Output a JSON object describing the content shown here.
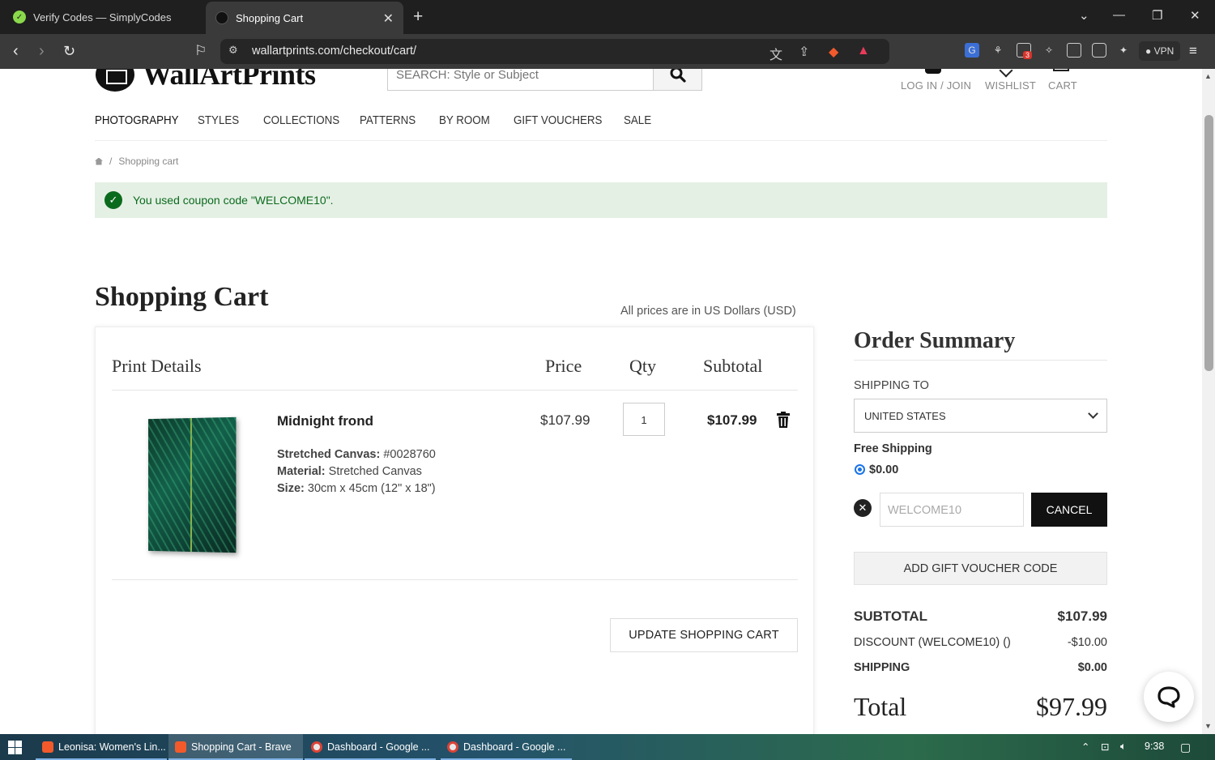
{
  "browser": {
    "tabs": [
      {
        "title": "Verify Codes — SimplyCodes",
        "active": false
      },
      {
        "title": "Shopping Cart",
        "active": true
      }
    ],
    "url": "wallartprints.com/checkout/cart/",
    "vpn_label": "VPN",
    "extension_badge": "3",
    "brave_badge": "8"
  },
  "site": {
    "logo_text": "WallArtPrints",
    "search_placeholder": "SEARCH: Style or Subject",
    "header_links": {
      "login": "LOG IN / JOIN",
      "wishlist": "WISHLIST",
      "cart": "CART"
    },
    "nav": [
      "PHOTOGRAPHY",
      "STYLES",
      "COLLECTIONS",
      "PATTERNS",
      "BY ROOM",
      "GIFT VOUCHERS",
      "SALE"
    ]
  },
  "breadcrumb": {
    "separator": "/",
    "current": "Shopping cart"
  },
  "notice": {
    "text": "You used coupon code \"WELCOME10\"."
  },
  "cart": {
    "title": "Shopping Cart",
    "currency_note": "All prices are in US Dollars (USD)",
    "columns": {
      "details": "Print Details",
      "price": "Price",
      "qty": "Qty",
      "subtotal": "Subtotal"
    },
    "items": [
      {
        "name": "Midnight frond",
        "attributes": [
          {
            "label": "Stretched Canvas:",
            "value": "#0028760"
          },
          {
            "label": "Material:",
            "value": "Stretched Canvas"
          },
          {
            "label": "Size:",
            "value": "30cm x 45cm (12\" x 18\")"
          }
        ],
        "price": "$107.99",
        "qty": "1",
        "subtotal": "$107.99"
      }
    ],
    "update_button": "UPDATE SHOPPING CART"
  },
  "summary": {
    "title": "Order Summary",
    "shipping_to_label": "SHIPPING TO",
    "shipping_country": "UNITED STATES",
    "shipping_method": "Free Shipping",
    "shipping_method_price": "$0.00",
    "coupon_value": "WELCOME10",
    "cancel_button": "CANCEL",
    "gift_voucher_button": "ADD GIFT VOUCHER CODE",
    "rows": {
      "subtotal_label": "SUBTOTAL",
      "subtotal_value": "$107.99",
      "discount_label": "DISCOUNT (WELCOME10) ()",
      "discount_value": "-$10.00",
      "shipping_label": "SHIPPING",
      "shipping_value": "$0.00"
    },
    "total_label": "Total",
    "total_value": "$97.99"
  },
  "taskbar": {
    "items": [
      {
        "title": "Leonisa: Women's Lin...",
        "active": false
      },
      {
        "title": "Shopping Cart - Brave",
        "active": true
      },
      {
        "title": "Dashboard - Google ...",
        "active": false
      },
      {
        "title": "Dashboard - Google ...",
        "active": false
      }
    ],
    "time": "9:38"
  },
  "colors": {
    "success_green": "#0b6b1d",
    "notice_bg": "#e5f0e5",
    "button_dark": "#111111"
  }
}
